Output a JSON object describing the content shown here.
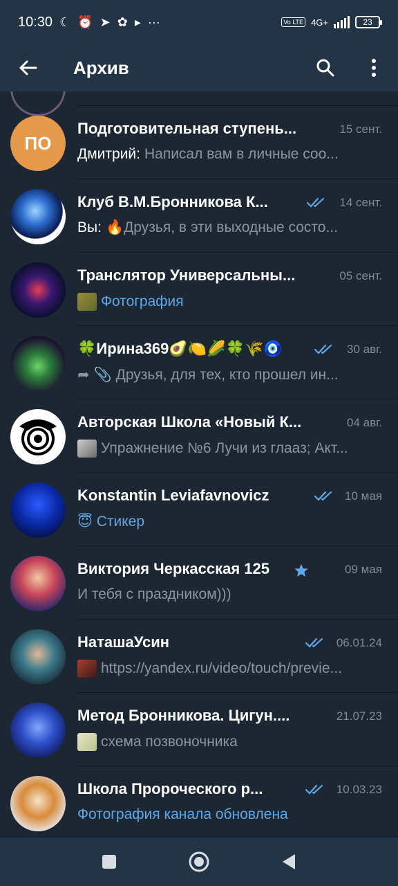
{
  "status_bar": {
    "time": "10:30",
    "lte_label": "Vo LTE",
    "network": "4G+",
    "battery": "23"
  },
  "header": {
    "title": "Архив"
  },
  "chats": [
    {
      "name": "Подготовительная ступень...",
      "date": "15 сент.",
      "sender": "Дмитрий:",
      "message": "Написал вам в личные соо...",
      "avatar_text": "ПО",
      "avatar_color": "#e5994a",
      "read": false
    },
    {
      "name": "Клуб В.М.Бронникова К...",
      "date": "14 сент.",
      "sender": "Вы:",
      "message": "🔥Друзья, в эти выходные состо...",
      "read": true
    },
    {
      "name": "Транслятор Универсальны...",
      "date": "05 сент.",
      "message": "Фотография",
      "message_style": "blue",
      "read": false
    },
    {
      "name": "🍀Ирина369🥑🍋🌽🍀🌾🧿",
      "date": "30 авг.",
      "message": "📎 Друзья, для тех, кто прошел ин...",
      "read": true
    },
    {
      "name": "Авторская Школа «Новый К...",
      "date": "04 авг.",
      "message": "Упражнение №6 Лучи из глааз; Акт...",
      "read": false
    },
    {
      "name": "Konstantin Leviafavnovicz",
      "date": "10 мая",
      "message": "😇 Стикер",
      "message_style": "blue",
      "read": true
    },
    {
      "name": "Виктория Черкасская 125",
      "date": "09 мая",
      "message": "И тебя с праздником)))",
      "read": false,
      "star": true
    },
    {
      "name": "НаташаУсин",
      "date": "06.01.24",
      "message": "https://yandex.ru/video/touch/previe...",
      "read": true
    },
    {
      "name": "Метод Бронникова. Цигун....",
      "date": "21.07.23",
      "message": "схема позвоночника",
      "read": false
    },
    {
      "name": "Школа Пророческого р...",
      "date": "10.03.23",
      "message": "Фотография канала обновлена",
      "message_style": "blue",
      "read": true
    }
  ],
  "colors": {
    "background": "#1d2733",
    "header": "#243447",
    "accent": "#5fa8e5",
    "muted": "#8896a3"
  }
}
